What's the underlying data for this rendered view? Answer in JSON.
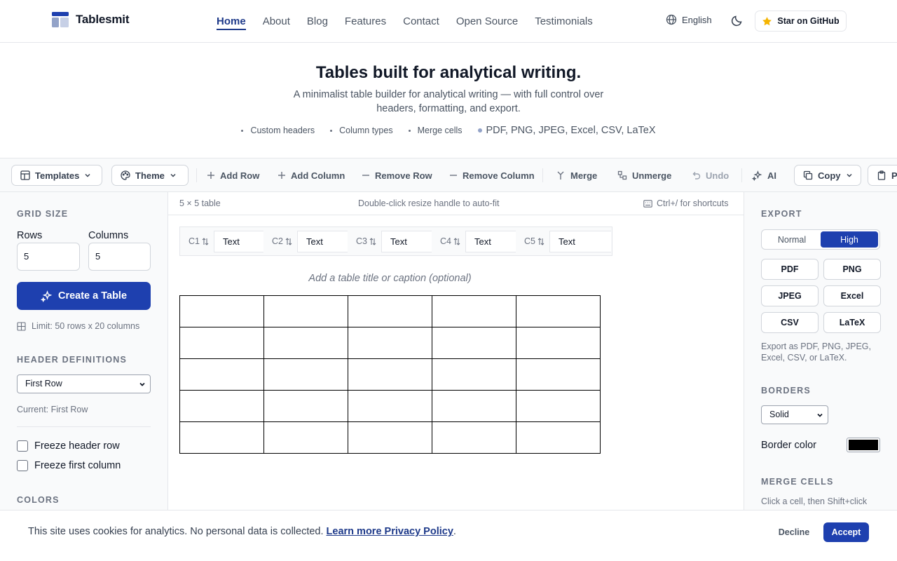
{
  "brand": {
    "name": "Tablesmit",
    "logo": "grid-logo-icon"
  },
  "nav": {
    "items": [
      {
        "label": "Home",
        "active": true
      },
      {
        "label": "About"
      },
      {
        "label": "Blog"
      },
      {
        "label": "Features"
      },
      {
        "label": "Contact"
      },
      {
        "label": "Open Source"
      },
      {
        "label": "Testimonials"
      }
    ],
    "language": "English",
    "github_label": "Star on GitHub"
  },
  "hero": {
    "title": "Tables built for analytical writing.",
    "subtitle": "A minimalist table builder for analytical writing — with full control over headers, formatting, and export.",
    "features": [
      "Custom headers",
      "Column types",
      "Merge cells",
      "PDF, PNG, JPEG, Excel, CSV, LaTeX"
    ]
  },
  "toolbar": {
    "templates": "Templates",
    "theme": "Theme",
    "add_row": "Add Row",
    "add_column": "Add Column",
    "remove_row": "Remove Row",
    "remove_column": "Remove Column",
    "merge": "Merge",
    "unmerge": "Unmerge",
    "undo": "Undo",
    "ai": "AI",
    "copy": "Copy",
    "paste": "P"
  },
  "left": {
    "grid_size_title": "GRID SIZE",
    "rows_label": "Rows",
    "columns_label": "Columns",
    "rows_value": "5",
    "columns_value": "5",
    "create_button": "Create a Table",
    "limit": "Limit: 50 rows x 20 columns",
    "header_defs_title": "HEADER DEFINITIONS",
    "header_select": "First Row",
    "current_header": "Current: First Row",
    "freeze_header": "Freeze header row",
    "freeze_first_col": "Freeze first column",
    "colors_title": "COLORS"
  },
  "main": {
    "table_size": "5 × 5 table",
    "hint": "Double-click resize handle to auto-fit",
    "shortcuts": "Ctrl+/ for shortcuts",
    "columns": [
      {
        "name": "C1",
        "type": "Text"
      },
      {
        "name": "C2",
        "type": "Text"
      },
      {
        "name": "C3",
        "type": "Text"
      },
      {
        "name": "C4",
        "type": "Text"
      },
      {
        "name": "C5",
        "type": "Text"
      }
    ],
    "caption_placeholder": "Add a table title or caption (optional)",
    "rows": 5,
    "cols": 5
  },
  "right": {
    "export_title": "EXPORT",
    "quality_normal": "Normal",
    "quality_high": "High",
    "formats": [
      "PDF",
      "PNG",
      "JPEG",
      "Excel",
      "CSV",
      "LaTeX"
    ],
    "export_note": "Export as PDF, PNG, JPEG, Excel, CSV, or LaTeX.",
    "borders_title": "BORDERS",
    "border_style": "Solid",
    "border_color_label": "Border color",
    "border_color": "#000000",
    "merge_title": "MERGE CELLS",
    "merge_note": "Click a cell, then Shift+click"
  },
  "cookie": {
    "message": "This site uses cookies for analytics. No personal data is collected.",
    "link": "Learn more Privacy Policy",
    "decline": "Decline",
    "accept": "Accept"
  },
  "colors": {
    "accent": "#1e40af",
    "nav_active": "#1e3a8a",
    "star": "#f5b400"
  }
}
